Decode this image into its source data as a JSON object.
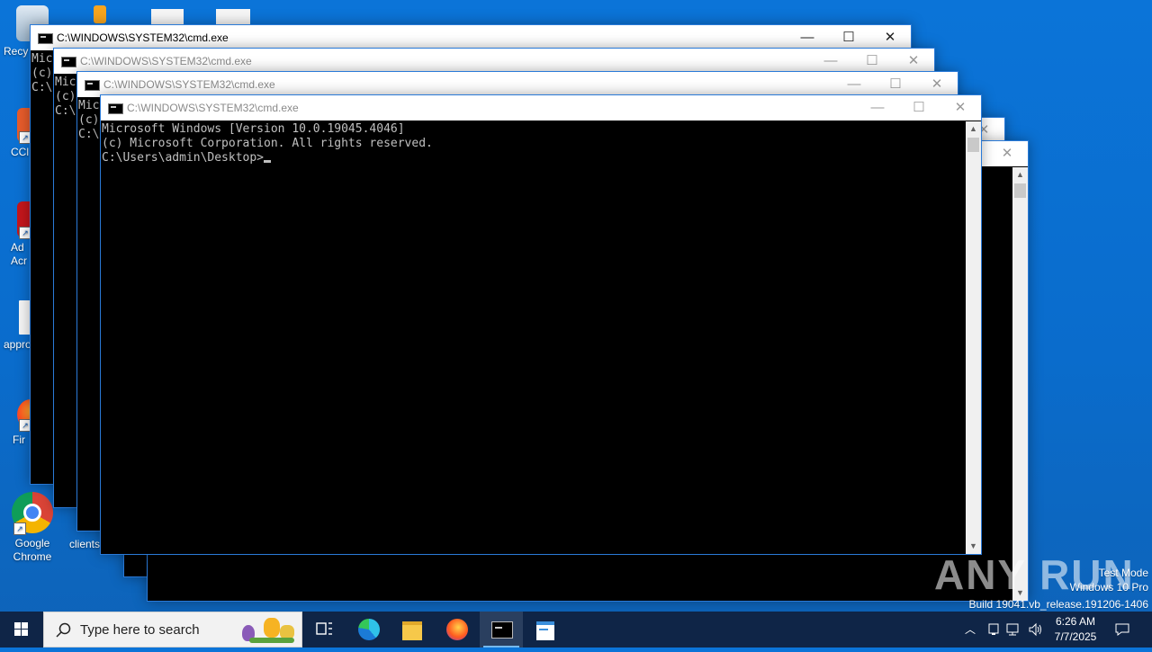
{
  "desktop": {
    "icons": [
      {
        "label": "Recy",
        "icon": "recycle-bin-icon"
      },
      {
        "label": "CCl",
        "icon": "ccleaner-icon"
      },
      {
        "label": "Ad Acr",
        "icon": "adobe-acrobat-icon"
      },
      {
        "label": "appro",
        "icon": "document-icon"
      },
      {
        "label": "Fir",
        "icon": "firefox-icon"
      },
      {
        "label": "Google Chrome",
        "icon": "chrome-icon"
      },
      {
        "label": "clients",
        "icon": "file-icon"
      }
    ]
  },
  "windows": [
    {
      "title": "C:\\WINDOWS\\SYSTEM32\\cmd.exe",
      "lines": [
        "Mic",
        "(c)",
        "",
        "C:\\"
      ]
    },
    {
      "title": "C:\\WINDOWS\\SYSTEM32\\cmd.exe",
      "lines": [
        "Mic",
        "(c)",
        "",
        "C:\\"
      ]
    },
    {
      "title": "C:\\WINDOWS\\SYSTEM32\\cmd.exe",
      "lines": [
        "Mic",
        "(c)",
        "",
        "C:\\"
      ]
    },
    {
      "title": "C:\\WINDOWS\\SYSTEM32\\cmd.exe",
      "lines": [
        "Microsoft Windows [Version 10.0.19045.4046]",
        "(c) Microsoft Corporation. All rights reserved.",
        "",
        "C:\\Users\\admin\\Desktop>"
      ]
    }
  ],
  "window_controls": {
    "minimize": "—",
    "maximize": "☐",
    "close": "✕"
  },
  "watermark": {
    "brand": "ANY RUN",
    "line1": "Test Mode",
    "line2": "Windows 10 Pro",
    "line3": "Build 19041.vb_release.191206-1406"
  },
  "taskbar": {
    "search_placeholder": "Type here to search",
    "apps": [
      "task-view-icon",
      "edge-icon",
      "file-explorer-icon",
      "firefox-icon",
      "cmd-icon",
      "notepad-icon"
    ],
    "time": "6:26 AM",
    "date": "7/7/2025"
  },
  "colors": {
    "desktop": "#0a6fd1",
    "taskbar": "#0f2547",
    "console_text": "#c0c0c0"
  }
}
